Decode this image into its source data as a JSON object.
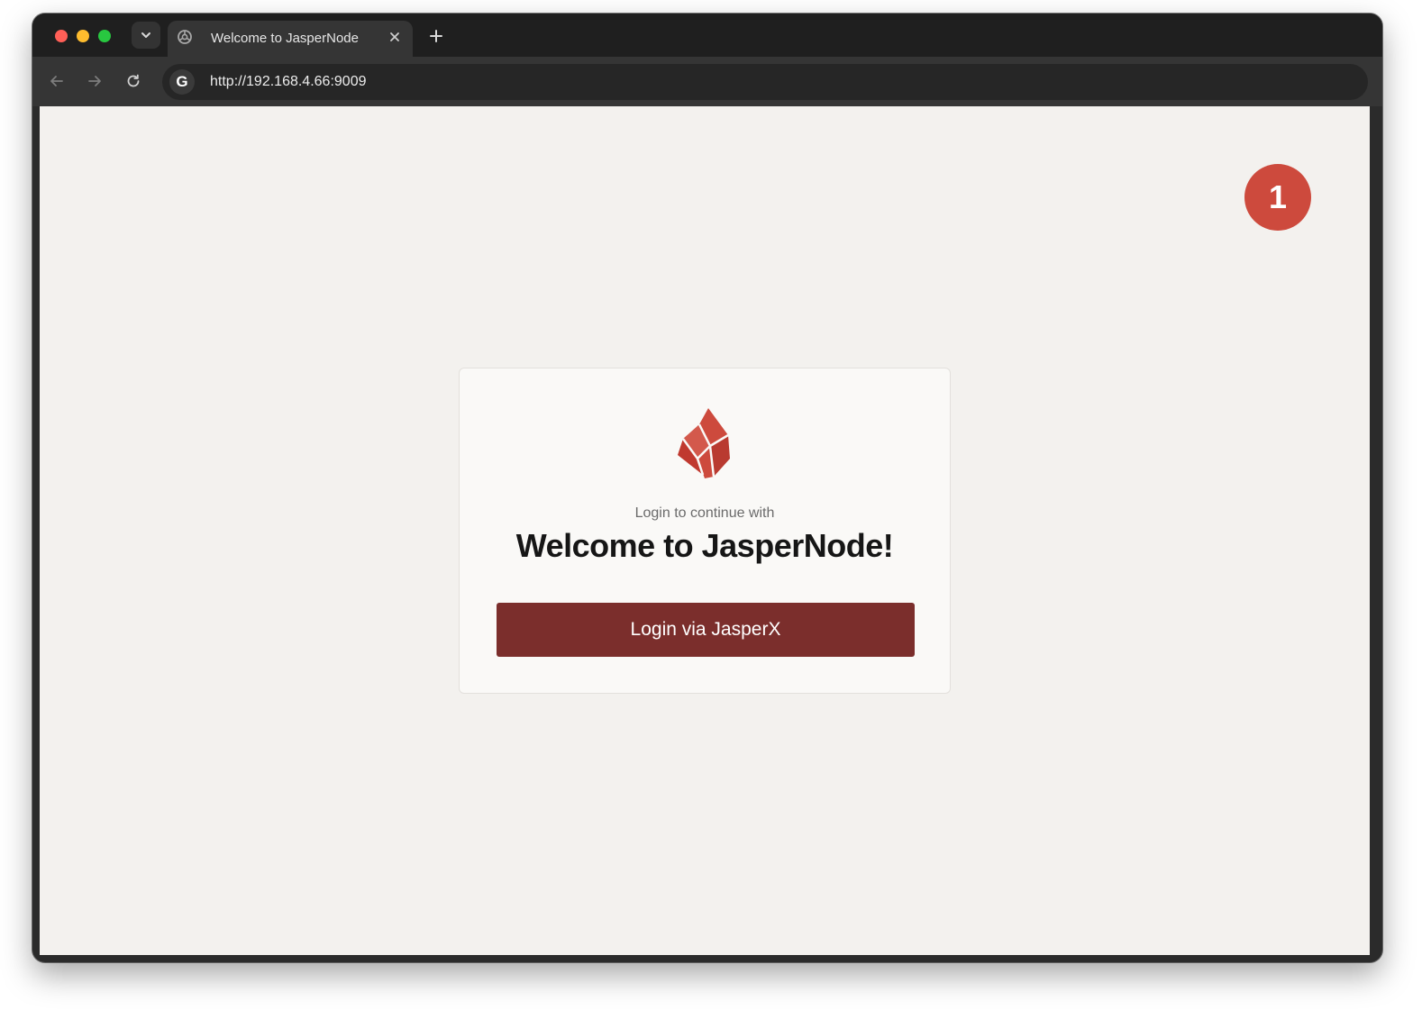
{
  "browser": {
    "tab_title": "Welcome to JasperNode",
    "url": "http://192.168.4.66:9009",
    "omnibox_icon_letter": "G",
    "icons": {
      "back": "arrow-left-icon",
      "forward": "arrow-right-icon",
      "reload": "reload-icon",
      "tab_close": "close-icon",
      "new_tab": "plus-icon",
      "tab_list": "chevron-down-icon"
    }
  },
  "page": {
    "step_badge": "1",
    "subtitle": "Login to continue with",
    "headline": "Welcome to JasperNode!",
    "login_button_label": "Login via JasperX"
  },
  "colors": {
    "accent_button": "#7b2e2c",
    "badge": "#cd4a3d",
    "logo": "#cd4a3d",
    "page_background": "#f3f1ee"
  }
}
